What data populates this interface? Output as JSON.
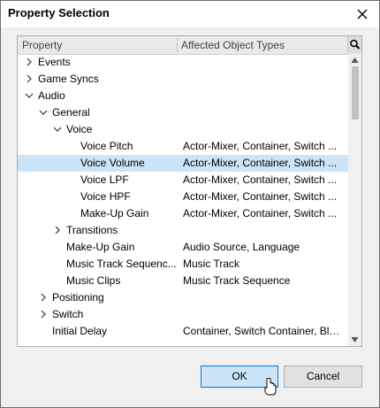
{
  "window": {
    "title": "Property Selection"
  },
  "columns": {
    "property": "Property",
    "types": "Affected Object Types"
  },
  "rows": [
    {
      "name": "Events",
      "types": "",
      "expander": "collapsed",
      "level": 0,
      "selected": false
    },
    {
      "name": "Game Syncs",
      "types": "",
      "expander": "collapsed",
      "level": 0,
      "selected": false
    },
    {
      "name": "Audio",
      "types": "",
      "expander": "expanded",
      "level": 0,
      "selected": false
    },
    {
      "name": "General",
      "types": "",
      "expander": "expanded",
      "level": 1,
      "selected": false
    },
    {
      "name": "Voice",
      "types": "",
      "expander": "expanded",
      "level": 2,
      "selected": false
    },
    {
      "name": "Voice Pitch",
      "types": "Actor-Mixer, Container, Switch ...",
      "expander": "none",
      "level": 3,
      "selected": false
    },
    {
      "name": "Voice Volume",
      "types": "Actor-Mixer, Container, Switch ...",
      "expander": "none",
      "level": 3,
      "selected": true
    },
    {
      "name": "Voice LPF",
      "types": "Actor-Mixer, Container, Switch ...",
      "expander": "none",
      "level": 3,
      "selected": false
    },
    {
      "name": "Voice HPF",
      "types": "Actor-Mixer, Container, Switch ...",
      "expander": "none",
      "level": 3,
      "selected": false
    },
    {
      "name": "Make-Up Gain",
      "types": "Actor-Mixer, Container, Switch ...",
      "expander": "none",
      "level": 3,
      "selected": false
    },
    {
      "name": "Transitions",
      "types": "",
      "expander": "collapsed",
      "level": 2,
      "selected": false
    },
    {
      "name": "Make-Up Gain",
      "types": "Audio Source, Language",
      "expander": "none",
      "level": 2,
      "selected": false
    },
    {
      "name": "Music Track Sequenc...",
      "types": "Music Track",
      "expander": "none",
      "level": 2,
      "selected": false
    },
    {
      "name": "Music Clips",
      "types": "Music Track Sequence",
      "expander": "none",
      "level": 2,
      "selected": false
    },
    {
      "name": "Positioning",
      "types": "",
      "expander": "collapsed",
      "level": 1,
      "selected": false
    },
    {
      "name": "Switch",
      "types": "",
      "expander": "collapsed",
      "level": 1,
      "selected": false
    },
    {
      "name": "Initial Delay",
      "types": "Container, Switch Container, Ble...",
      "expander": "none",
      "level": 1,
      "selected": false
    }
  ],
  "buttons": {
    "ok": "OK",
    "cancel": "Cancel"
  },
  "colors": {
    "selection": "#cce4f7",
    "ok_border": "#0078d7"
  },
  "icons": {
    "close": "close-icon",
    "search": "search-icon",
    "expanded": "chevron-down-icon",
    "collapsed": "chevron-right-icon"
  }
}
